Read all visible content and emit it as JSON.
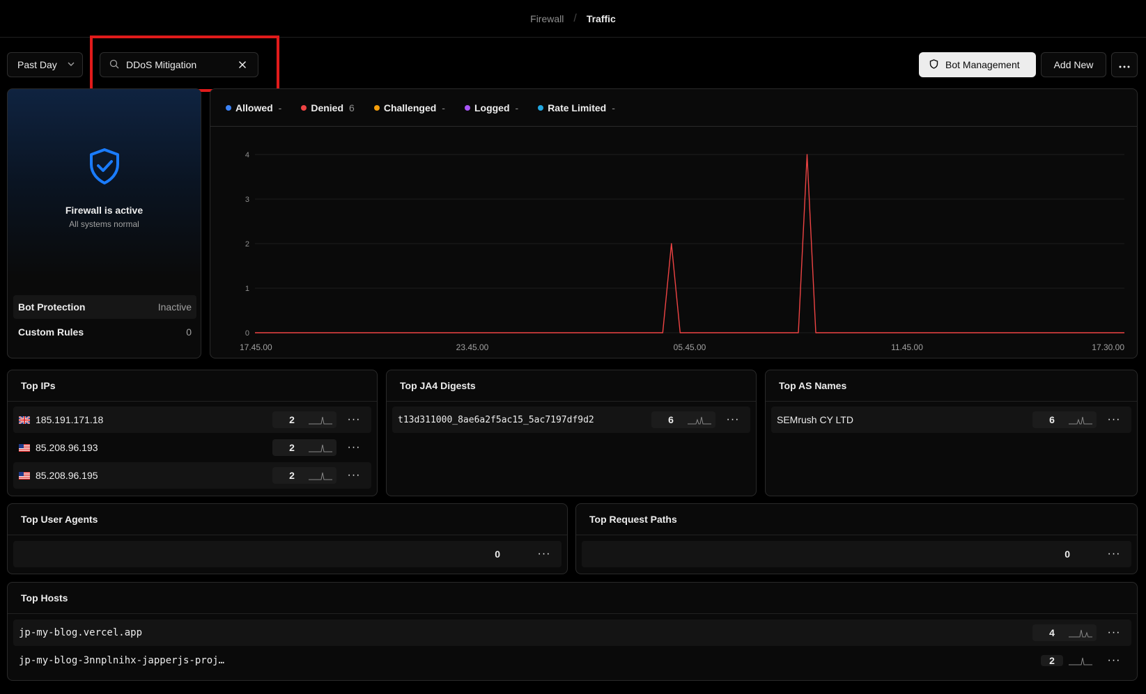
{
  "breadcrumb": {
    "parent": "Firewall",
    "separator": "/",
    "current": "Traffic"
  },
  "toolbar": {
    "time_range": "Past Day",
    "search_value": "DDoS Mitigation",
    "bot_management_label": "Bot Management",
    "add_new_label": "Add New"
  },
  "status": {
    "title": "Firewall is active",
    "subtitle": "All systems normal",
    "rows": [
      {
        "label": "Bot Protection",
        "value": "Inactive"
      },
      {
        "label": "Custom Rules",
        "value": "0"
      }
    ]
  },
  "legend": [
    {
      "name": "Allowed",
      "value": "-",
      "color": "#3b82f6"
    },
    {
      "name": "Denied",
      "value": "6",
      "color": "#ef4444"
    },
    {
      "name": "Challenged",
      "value": "-",
      "color": "#f59e0b"
    },
    {
      "name": "Logged",
      "value": "-",
      "color": "#a855f7"
    },
    {
      "name": "Rate Limited",
      "value": "-",
      "color": "#22a7e0"
    }
  ],
  "chart_data": {
    "type": "line",
    "x_ticks": [
      "17.45.00",
      "23.45.00",
      "05.45.00",
      "11.45.00",
      "17.30.00"
    ],
    "ylim": [
      0,
      4
    ],
    "y_ticks": [
      "0",
      "1",
      "2",
      "3",
      "4"
    ],
    "grid": true,
    "series": [
      {
        "name": "Denied",
        "color": "#ef4444",
        "points": [
          [
            0,
            0
          ],
          [
            0.469,
            0
          ],
          [
            0.479,
            2
          ],
          [
            0.489,
            0
          ],
          [
            0.625,
            0
          ],
          [
            0.635,
            4
          ],
          [
            0.645,
            0
          ],
          [
            1,
            0
          ]
        ]
      }
    ]
  },
  "top_ips": {
    "title": "Top IPs",
    "rows": [
      {
        "flag": "gb-flag-icon",
        "value": "185.191.171.18",
        "count": "2"
      },
      {
        "flag": "us-flag-icon",
        "value": "85.208.96.193",
        "count": "2"
      },
      {
        "flag": "us-flag-icon",
        "value": "85.208.96.195",
        "count": "2"
      }
    ]
  },
  "top_ja4": {
    "title": "Top JA4 Digests",
    "rows": [
      {
        "value": "t13d311000_8ae6a2f5ac15_5ac7197df9d2",
        "count": "6"
      }
    ]
  },
  "top_as": {
    "title": "Top AS Names",
    "rows": [
      {
        "value": "SEMrush CY LTD",
        "count": "6"
      }
    ]
  },
  "top_user_agents": {
    "title": "Top User Agents",
    "rows": [
      {
        "value": "",
        "count": "0"
      }
    ]
  },
  "top_request_paths": {
    "title": "Top Request Paths",
    "rows": [
      {
        "value": "",
        "count": "0"
      }
    ]
  },
  "top_hosts": {
    "title": "Top Hosts",
    "rows": [
      {
        "value": "jp-my-blog.vercel.app",
        "count": "4"
      },
      {
        "value": "jp-my-blog-3nnplnihx-japperjs-proj…",
        "count": "2"
      }
    ]
  }
}
